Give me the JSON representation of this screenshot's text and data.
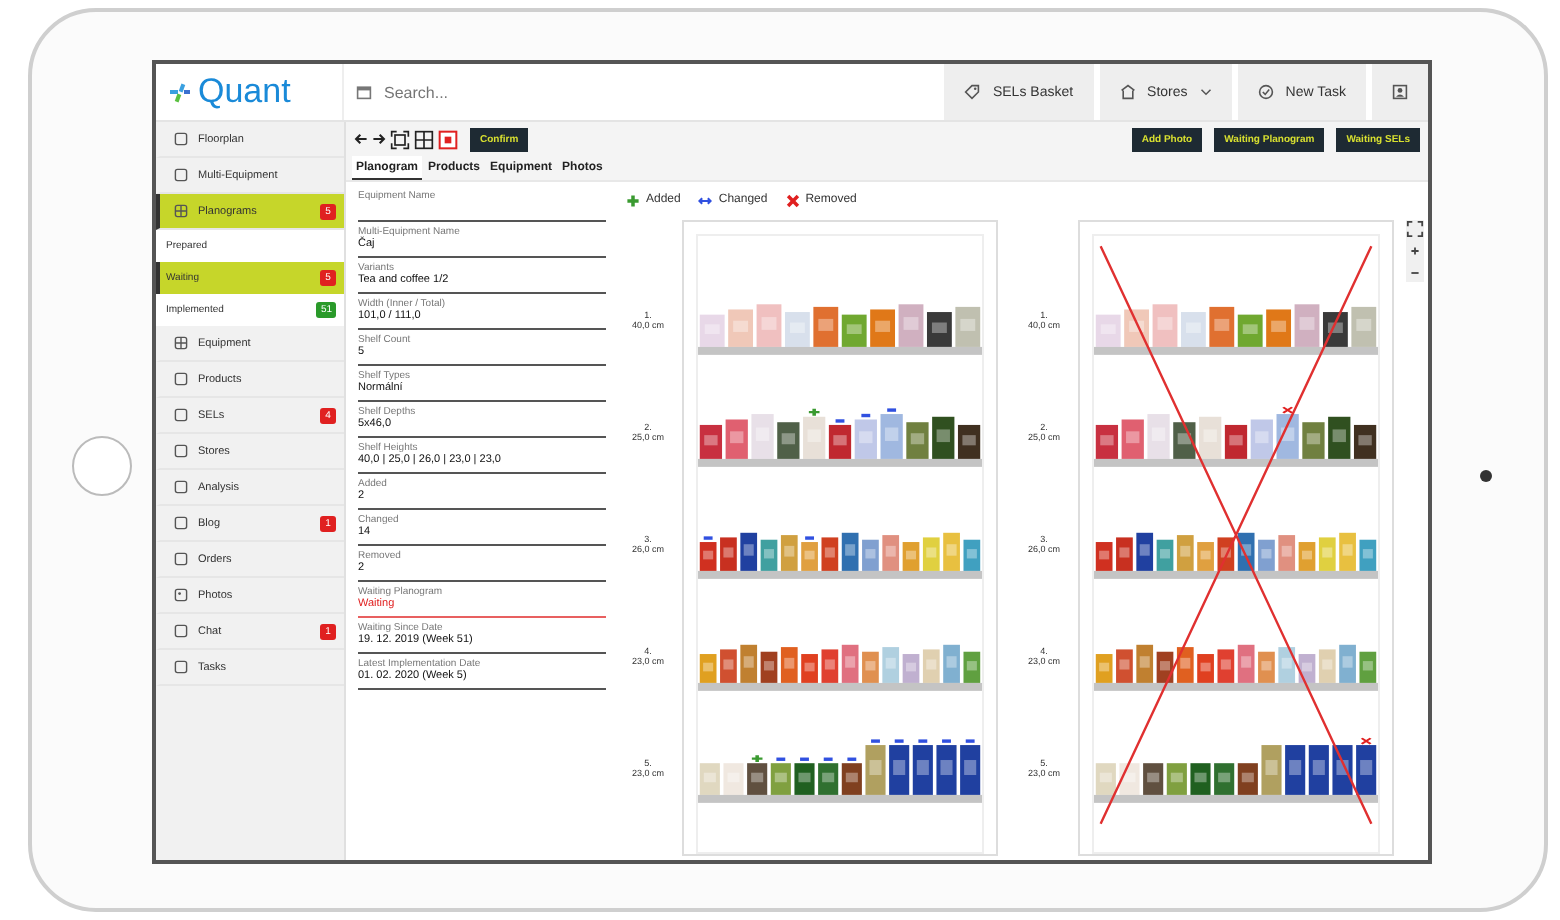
{
  "header": {
    "logo": "Quant",
    "search_placeholder": "Search...",
    "actions": [
      {
        "kind": "sels",
        "label": "SELs Basket"
      },
      {
        "kind": "stores",
        "label": "Stores"
      },
      {
        "kind": "task",
        "label": "New Task"
      },
      {
        "kind": "profile"
      }
    ]
  },
  "sidebar": {
    "items": [
      {
        "label": "Floorplan",
        "selected": false
      },
      {
        "label": "Multi-Equipment",
        "selected": false
      },
      {
        "label": "Planograms",
        "selected": true,
        "badge": {
          "label": "5",
          "color": "#e02020"
        },
        "children": [
          {
            "label": "Prepared",
            "selected": false
          },
          {
            "label": "Waiting",
            "selected": true,
            "badge": {
              "label": "5",
              "color": "#e02020"
            }
          },
          {
            "label": "Implemented",
            "selected": false,
            "badge": {
              "label": "51",
              "color": "#2a9a2a"
            }
          }
        ]
      },
      {
        "label": "Equipment",
        "selected": false
      },
      {
        "label": "Products",
        "selected": false
      },
      {
        "label": "SELs",
        "selected": false,
        "badge": {
          "label": "4",
          "color": "#e02020"
        }
      },
      {
        "label": "Stores",
        "selected": false
      },
      {
        "label": "Analysis",
        "selected": false
      },
      {
        "label": "Blog",
        "selected": false,
        "badge": {
          "label": "1",
          "color": "#e02020"
        }
      },
      {
        "label": "Orders",
        "selected": false
      },
      {
        "label": "Photos",
        "selected": false
      },
      {
        "label": "Chat",
        "selected": false,
        "badge": {
          "label": "1",
          "color": "#e02020"
        }
      },
      {
        "label": "Tasks",
        "selected": false
      }
    ]
  },
  "toolbar": {
    "confirm": "Confirm",
    "actions": [
      "Add Photo",
      "Waiting Planogram",
      "Waiting SELs"
    ]
  },
  "tabs": [
    {
      "label": "Planogram",
      "selected": true
    },
    {
      "label": "Products",
      "selected": false
    },
    {
      "label": "Equipment",
      "selected": false
    },
    {
      "label": "Photos",
      "selected": false
    }
  ],
  "fields": [
    {
      "label": "Equipment Name",
      "alert": false
    },
    {
      "label": "Multi-Equipment Name",
      "value": "Čaj",
      "alert": false
    },
    {
      "label": "Variants",
      "value": "Tea and coffee 1/2",
      "alert": false
    },
    {
      "label": "Width (Inner / Total)",
      "value": "101,0 / 111,0",
      "alert": false
    },
    {
      "label": "Shelf Count",
      "value": "5",
      "alert": false
    },
    {
      "label": "Shelf Types",
      "value": "Normální",
      "alert": false
    },
    {
      "label": "Shelf Depths",
      "value": "5x46,0",
      "alert": false
    },
    {
      "label": "Shelf Heights",
      "value": "40,0 | 25,0 | 26,0 | 23,0 | 23,0",
      "alert": false
    },
    {
      "label": "Added",
      "value": "2",
      "alert": false
    },
    {
      "label": "Changed",
      "value": "14",
      "alert": false
    },
    {
      "label": "Removed",
      "value": "2",
      "alert": false
    },
    {
      "label": "Waiting Planogram",
      "value": "Waiting",
      "alert": true
    },
    {
      "label": "Waiting Since Date",
      "value": "19. 12. 2019 (Week 51)",
      "alert": false
    },
    {
      "label": "Latest Implementation Date",
      "value": "01. 02. 2020 (Week 5)",
      "alert": false
    }
  ],
  "legend": [
    {
      "kind": "added",
      "label": "Added"
    },
    {
      "kind": "changed",
      "label": "Changed"
    },
    {
      "kind": "removed",
      "label": "Removed"
    }
  ],
  "planograms": [
    {
      "crossed_out": false,
      "shelves": [
        {
          "number": "1.",
          "height": "40,0 cm"
        },
        {
          "number": "2.",
          "height": "25,0 cm"
        },
        {
          "number": "3.",
          "height": "26,0 cm"
        },
        {
          "number": "4.",
          "height": "23,0 cm"
        },
        {
          "number": "5.",
          "height": "23,0 cm"
        }
      ]
    },
    {
      "crossed_out": true,
      "shelves": [
        {
          "number": "1.",
          "height": "40,0 cm"
        },
        {
          "number": "2.",
          "height": "25,0 cm"
        },
        {
          "number": "3.",
          "height": "26,0 cm"
        },
        {
          "number": "4.",
          "height": "23,0 cm"
        },
        {
          "number": "5.",
          "height": "23,0 cm"
        }
      ]
    }
  ]
}
